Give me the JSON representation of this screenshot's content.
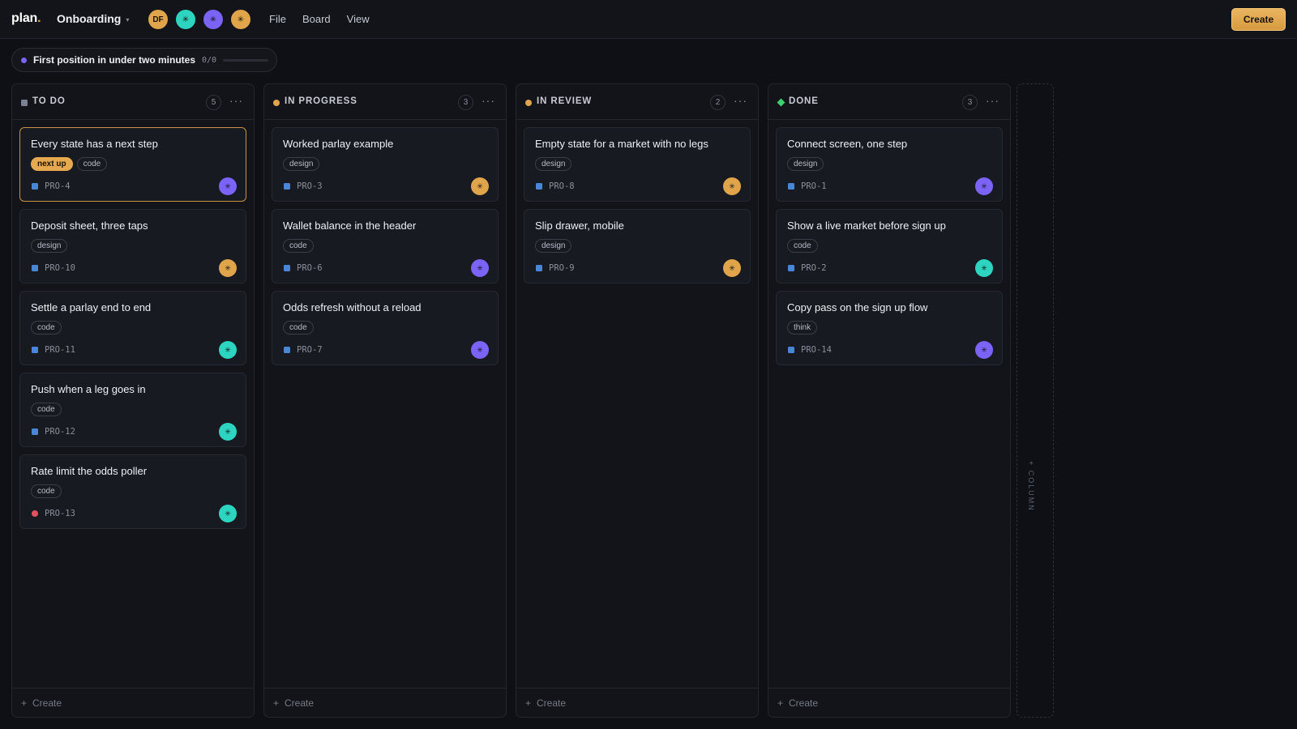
{
  "app": {
    "logo_text": "plan",
    "logo_dot": ".",
    "project": "Onboarding",
    "caret": "▾"
  },
  "avatars": [
    {
      "initials": "DF",
      "color": "#e0a44a"
    },
    {
      "initials": "✳",
      "color": "#2dd4bf"
    },
    {
      "initials": "✳",
      "color": "#7a63f5"
    },
    {
      "initials": "✳",
      "color": "#e0a44a"
    }
  ],
  "menu": [
    "File",
    "Board",
    "View"
  ],
  "create_label": "Create",
  "goal": {
    "text": "First position in under two minutes",
    "count": "0/0",
    "progress": 0
  },
  "colors": {
    "todo": "#7c8190",
    "in_progress": "#e0a44a",
    "in_review": "#e0a44a",
    "done": "#3ecf6e",
    "accent": "#e7a94f"
  },
  "columns": [
    {
      "title": "TO DO",
      "count": "5",
      "more": "···",
      "footer": "Create",
      "cards": [
        {
          "title": "Every state has a next step",
          "tags": [
            "next up",
            "code"
          ],
          "id": "PRO-4",
          "avatar": "✳",
          "avatar_color": "#7a63f5",
          "priority": "normal",
          "active": true
        },
        {
          "title": "Deposit sheet, three taps",
          "tags": [
            "design"
          ],
          "id": "PRO-10",
          "avatar": "✳",
          "avatar_color": "#e0a44a",
          "priority": "normal"
        },
        {
          "title": "Settle a parlay end to end",
          "tags": [
            "code"
          ],
          "id": "PRO-11",
          "avatar": "✳",
          "avatar_color": "#2dd4bf",
          "priority": "normal"
        },
        {
          "title": "Push when a leg goes in",
          "tags": [
            "code"
          ],
          "id": "PRO-12",
          "avatar": "✳",
          "avatar_color": "#2dd4bf",
          "priority": "normal"
        },
        {
          "title": "Rate limit the odds poller",
          "tags": [
            "code"
          ],
          "id": "PRO-13",
          "avatar": "✳",
          "avatar_color": "#2dd4bf",
          "priority": "urgent"
        }
      ]
    },
    {
      "title": "IN PROGRESS",
      "count": "3",
      "more": "···",
      "footer": "Create",
      "cards": [
        {
          "title": "Worked parlay example",
          "tags": [
            "design"
          ],
          "id": "PRO-3",
          "avatar": "✳",
          "avatar_color": "#e0a44a",
          "priority": "normal"
        },
        {
          "title": "Wallet balance in the header",
          "tags": [
            "code"
          ],
          "id": "PRO-6",
          "avatar": "✳",
          "avatar_color": "#7a63f5",
          "priority": "normal"
        },
        {
          "title": "Odds refresh without a reload",
          "tags": [
            "code"
          ],
          "id": "PRO-7",
          "avatar": "✳",
          "avatar_color": "#7a63f5",
          "priority": "normal"
        }
      ]
    },
    {
      "title": "IN REVIEW",
      "count": "2",
      "more": "···",
      "footer": "Create",
      "cards": [
        {
          "title": "Empty state for a market with no legs",
          "tags": [
            "design"
          ],
          "id": "PRO-8",
          "avatar": "✳",
          "avatar_color": "#e0a44a",
          "priority": "normal"
        },
        {
          "title": "Slip drawer, mobile",
          "tags": [
            "design"
          ],
          "id": "PRO-9",
          "avatar": "✳",
          "avatar_color": "#e0a44a",
          "priority": "normal"
        }
      ]
    },
    {
      "title": "DONE",
      "count": "3",
      "more": "···",
      "footer": "Create",
      "cards": [
        {
          "title": "Connect screen, one step",
          "tags": [
            "design"
          ],
          "id": "PRO-1",
          "avatar": "✳",
          "avatar_color": "#7a63f5",
          "priority": "normal"
        },
        {
          "title": "Show a live market before sign up",
          "tags": [
            "code"
          ],
          "id": "PRO-2",
          "avatar": "✳",
          "avatar_color": "#2dd4bf",
          "priority": "normal"
        },
        {
          "title": "Copy pass on the sign up flow",
          "tags": [
            "think"
          ],
          "id": "PRO-14",
          "avatar": "✳",
          "avatar_color": "#7a63f5",
          "priority": "normal"
        }
      ]
    }
  ],
  "add_column": {
    "plus": "+",
    "label": "COLUMN"
  }
}
